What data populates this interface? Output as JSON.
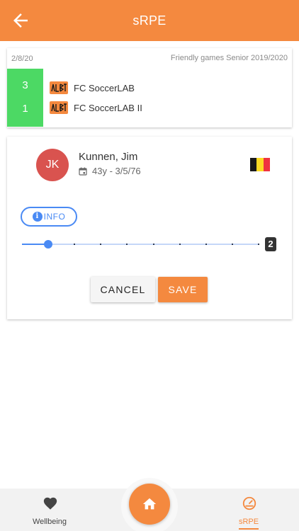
{
  "header": {
    "title": "sRPE"
  },
  "match": {
    "date": "2/8/20",
    "competition": "Friendly games Senior 2019/2020",
    "home": {
      "score": "3",
      "name": "FC SoccerLAB"
    },
    "away": {
      "score": "1",
      "name": "FC SoccerLAB II"
    },
    "score_color": "#4cd964"
  },
  "player": {
    "initials": "JK",
    "name": "Kunnen, Jim",
    "meta": "43y - 3/5/76",
    "avatar_color": "#d9534f",
    "flag_colors": [
      "#1a1a1a",
      "#fdda24",
      "#ef3340"
    ]
  },
  "rating": {
    "info_label": "INFO",
    "value": "2",
    "value_number": 1,
    "min": 0,
    "max": 9
  },
  "actions": {
    "cancel": "CANCEL",
    "save": "SAVE"
  },
  "bottom_nav": {
    "wellbeing": {
      "label": "Wellbeing",
      "icon": "heart-icon"
    },
    "home": {
      "icon": "home-icon"
    },
    "srpe": {
      "label": "sRPE",
      "icon": "speedometer-icon"
    }
  },
  "colors": {
    "accent": "#f4893f",
    "info": "#4a8af4"
  }
}
